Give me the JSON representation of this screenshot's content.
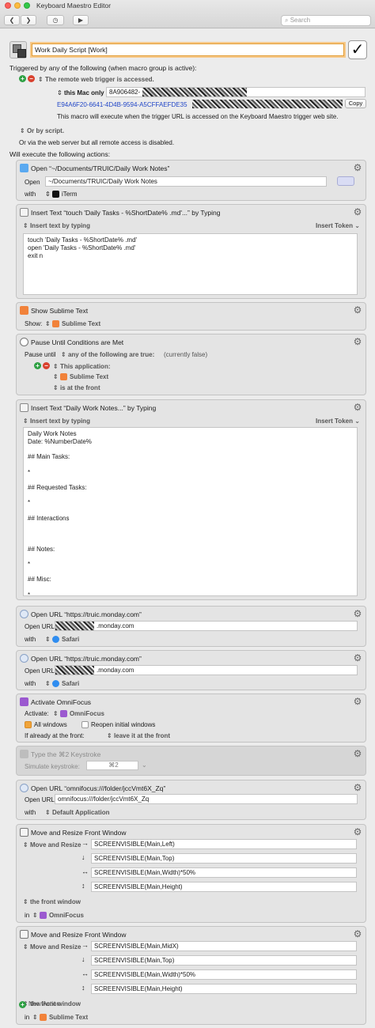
{
  "window": {
    "title": "Keyboard Maestro Editor",
    "search_placeholder": "Search",
    "toolbar": {
      "back": "❮",
      "forward": "❯",
      "clock": "◷",
      "run": "▶"
    }
  },
  "macro": {
    "name": "Work Daily Script [Work]"
  },
  "triggers": {
    "heading": "Triggered by any of the following (when macro group is active):",
    "remote_title": "The remote web trigger is accessed.",
    "scope": "this Mac only",
    "id_prefix": "8A906482-",
    "url_prefix": "E94A6F20-6641-4D4B-9594-A5CFFAEFDE35",
    "copy_label": "Copy",
    "note": "This macro will execute when the trigger URL is accessed on the Keyboard Maestro trigger web site.",
    "or_script": "Or by script.",
    "or_web": "Or via the web server but all remote access is disabled."
  },
  "actions_heading": "Will execute the following actions:",
  "actions": {
    "open_notes": {
      "title": "Open “~/Documents/TRUIC/Daily Work Notes”",
      "open_label": "Open",
      "path": "~/Documents/TRUIC/Daily Work Notes",
      "with_label": "with",
      "app": "iTerm"
    },
    "insert_touch": {
      "title": "Insert Text “touch 'Daily Tasks - %ShortDate% .md'...” by Typing",
      "mode": "Insert text by typing",
      "token_label": "Insert Token",
      "text": "touch 'Daily Tasks - %ShortDate% .md'\nopen 'Daily Tasks - %ShortDate% .md'\nexit n"
    },
    "show_sublime": {
      "title": "Show Sublime Text",
      "show_label": "Show:",
      "app": "Sublime Text"
    },
    "pause": {
      "title": "Pause Until Conditions are Met",
      "pause_label": "Pause until",
      "condition": "any of the following are true:",
      "state": "(currently false)",
      "this_app": "This application:",
      "app": "Sublime Text",
      "front": "is at the front"
    },
    "insert_notes": {
      "title": "Insert Text “Daily Work Notes...” by Typing",
      "mode": "Insert text by typing",
      "token_label": "Insert Token",
      "text": "Daily Work Notes\nDate: %NumberDate%\n\n## Main Tasks:\n\n*\n\n## Requested Tasks:\n\n*\n\n## Interactions\n\n\n\n## Notes:\n\n*\n\n## Misc:\n\n*"
    },
    "open_url_1": {
      "title": "Open URL “https://truic.monday.com”",
      "url_label": "Open URL",
      "url_suffix": ".monday.com",
      "with_label": "with",
      "app": "Safari"
    },
    "open_url_2": {
      "title": "Open URL “https://truic.monday.com”",
      "url_label": "Open URL",
      "url_suffix": ".monday.com",
      "with_label": "with",
      "app": "Safari"
    },
    "activate_omni": {
      "title": "Activate OmniFocus",
      "activate_label": "Activate:",
      "app": "OmniFocus",
      "all_windows": "All windows",
      "reopen": "Reopen initial windows",
      "front_label": "If already at the front:",
      "front_action": "leave it at the front"
    },
    "keystroke": {
      "title": "Type the ⌘2 Keystroke",
      "label": "Simulate keystroke:",
      "value": "⌘2"
    },
    "open_omni_url": {
      "title": "Open URL “omnifocus:///folder/jccVmt6X_Zq”",
      "url_label": "Open URL",
      "url": "omnifocus:///folder/jccVmt6X_Zq",
      "with_label": "with",
      "app": "Default Application"
    },
    "resize_1": {
      "title": "Move and Resize Front Window",
      "mode": "Move and Resize",
      "left": "SCREENVISIBLE(Main,Left)",
      "top": "SCREENVISIBLE(Main,Top)",
      "width": "SCREENVISIBLE(Main,Width)*50%",
      "height": "SCREENVISIBLE(Main,Height)",
      "target": "the front window",
      "in_label": "in",
      "app": "OmniFocus"
    },
    "resize_2": {
      "title": "Move and Resize Front Window",
      "mode": "Move and Resize",
      "left": "SCREENVISIBLE(Main,MidX)",
      "top": "SCREENVISIBLE(Main,Top)",
      "width": "SCREENVISIBLE(Main,Width)*50%",
      "height": "SCREENVISIBLE(Main,Height)",
      "target": "the front window",
      "in_label": "in",
      "app": "Sublime Text"
    }
  },
  "new_action": "New Action",
  "icons": {
    "arrows": {
      "right": "→",
      "down": "↓",
      "horiz": "↔",
      "vert": "↕"
    },
    "updown": "⇕",
    "gear": "⚙",
    "plus": "+",
    "minus": "−",
    "check": "✓"
  },
  "colors": {
    "accent": "#e39d35",
    "link": "#2146c7",
    "plus": "#2ea043",
    "minus": "#d9412e"
  }
}
